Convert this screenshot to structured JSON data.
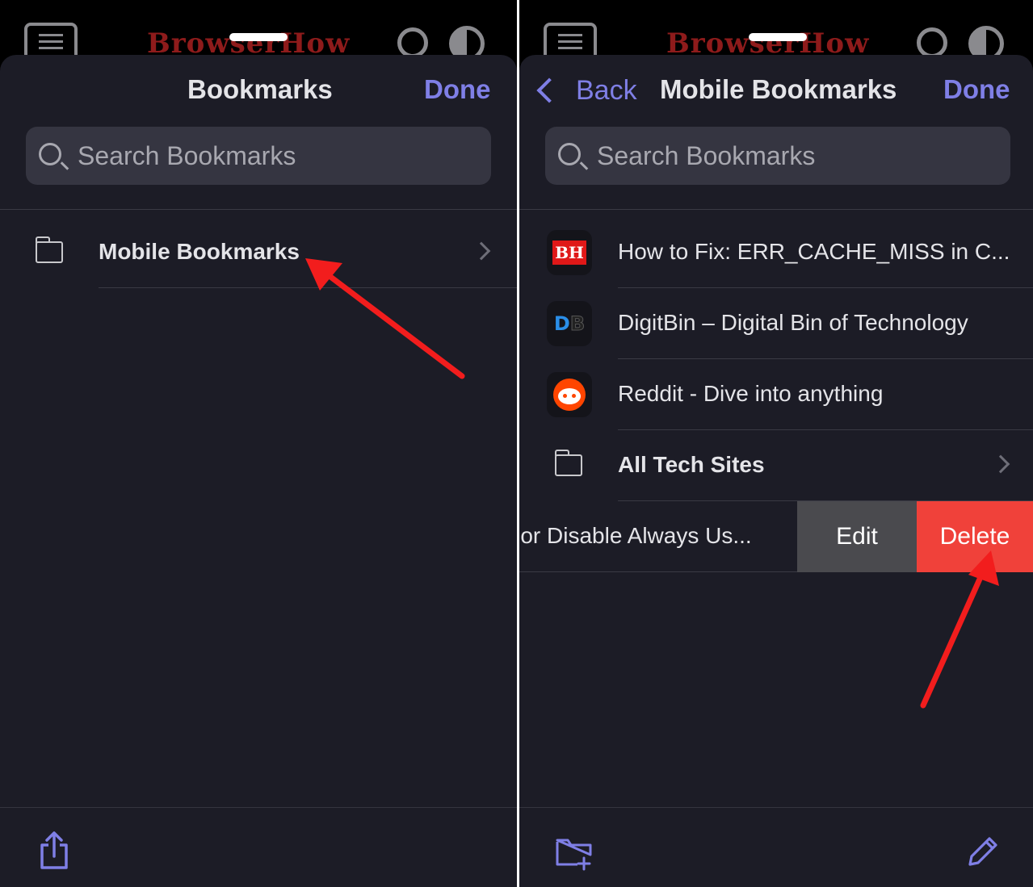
{
  "brand": {
    "logo_text": "BrowserHow",
    "accent_color": "#7f7fe6",
    "delete_color": "#f0413a",
    "annotation_color": "#f21d1d"
  },
  "left": {
    "title": "Bookmarks",
    "done_label": "Done",
    "search_placeholder": "Search Bookmarks",
    "rows": [
      {
        "label": "Mobile Bookmarks",
        "icon": "folder-icon"
      }
    ],
    "footer_icon": "share-icon"
  },
  "right": {
    "back_label": "Back",
    "title": "Mobile Bookmarks",
    "done_label": "Done",
    "search_placeholder": "Search Bookmarks",
    "rows": [
      {
        "label": "How to Fix: ERR_CACHE_MISS in C...",
        "icon": "browserhow-favicon",
        "favicon_text": "BH"
      },
      {
        "label": "DigitBin – Digital Bin of Technology",
        "icon": "digitbin-favicon",
        "favicon_text_1": "D",
        "favicon_text_2": "B"
      },
      {
        "label": "Reddit - Dive into anything",
        "icon": "reddit-favicon"
      },
      {
        "label": "All Tech Sites",
        "icon": "folder-icon"
      }
    ],
    "swiped_row": {
      "label": "e or Disable Always Us...",
      "edit_label": "Edit",
      "delete_label": "Delete"
    },
    "footer_left_icon": "new-folder-icon",
    "footer_right_icon": "pencil-icon"
  }
}
